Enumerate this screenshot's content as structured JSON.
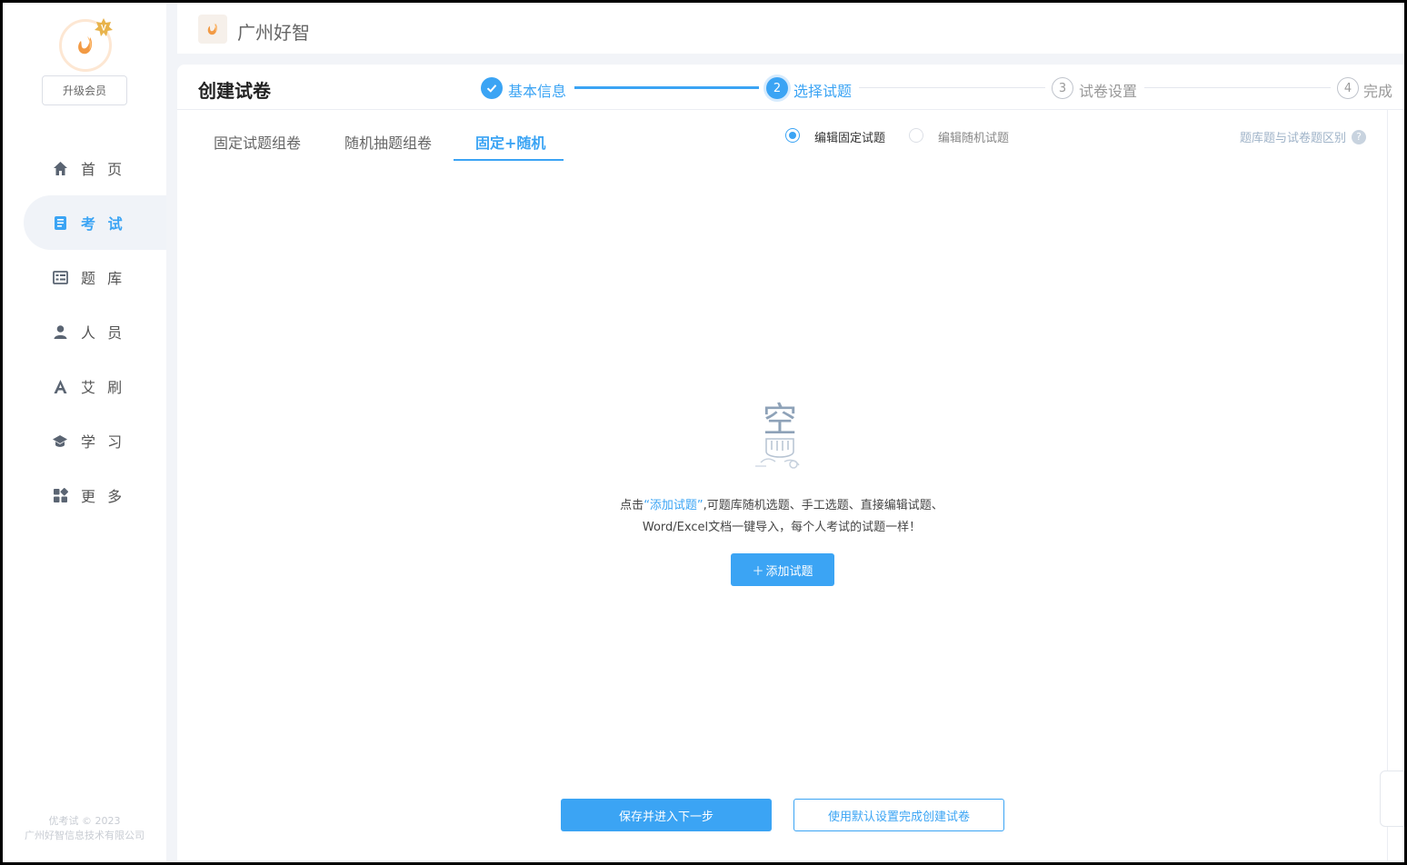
{
  "sidebar": {
    "upgrade_label": "升级会员",
    "items": [
      {
        "label": "首 页",
        "icon": "home-icon"
      },
      {
        "label": "考 试",
        "icon": "exam-book-icon"
      },
      {
        "label": "题 库",
        "icon": "question-bank-icon"
      },
      {
        "label": "人 员",
        "icon": "user-icon"
      },
      {
        "label": "艾 刷",
        "icon": "letter-a-icon"
      },
      {
        "label": "学 习",
        "icon": "graduation-cap-icon"
      },
      {
        "label": "更 多",
        "icon": "grid-more-icon"
      }
    ],
    "active_index": 1,
    "footer": {
      "line1": "优考试 © 2023",
      "line2": "广州好智信息技术有限公司"
    }
  },
  "header": {
    "company": "广州好智"
  },
  "page": {
    "title": "创建试卷",
    "steps": [
      {
        "number": "1",
        "label": "基本信息",
        "state": "done"
      },
      {
        "number": "2",
        "label": "选择试题",
        "state": "current"
      },
      {
        "number": "3",
        "label": "试卷设置",
        "state": "pending"
      },
      {
        "number": "4",
        "label": "完成",
        "state": "pending"
      }
    ],
    "tabs": [
      "固定试题组卷",
      "随机抽题组卷",
      "固定+随机"
    ],
    "active_tab": 2,
    "radios": [
      {
        "label": "编辑固定试题",
        "checked": true
      },
      {
        "label": "编辑随机试题",
        "checked": false
      }
    ],
    "help_link": "题库题与试卷题区别",
    "help_icon": "?",
    "empty": {
      "art_char": "空",
      "line1_prefix": "点击",
      "line1_highlight": "“添加试题”",
      "line1_suffix": ",可题库随机选题、手工选题、直接编辑试题、",
      "line2": "Word/Excel文档一键导入，每个人考试的试题一样！"
    },
    "add_button": "添加试题",
    "add_button_plus": "＋",
    "save_button": "保存并进入下一步",
    "default_button": "使用默认设置完成创建试卷"
  },
  "colors": {
    "accent": "#3ba4f4",
    "muted": "#c0c4cc",
    "bg": "#f2f4f8"
  }
}
